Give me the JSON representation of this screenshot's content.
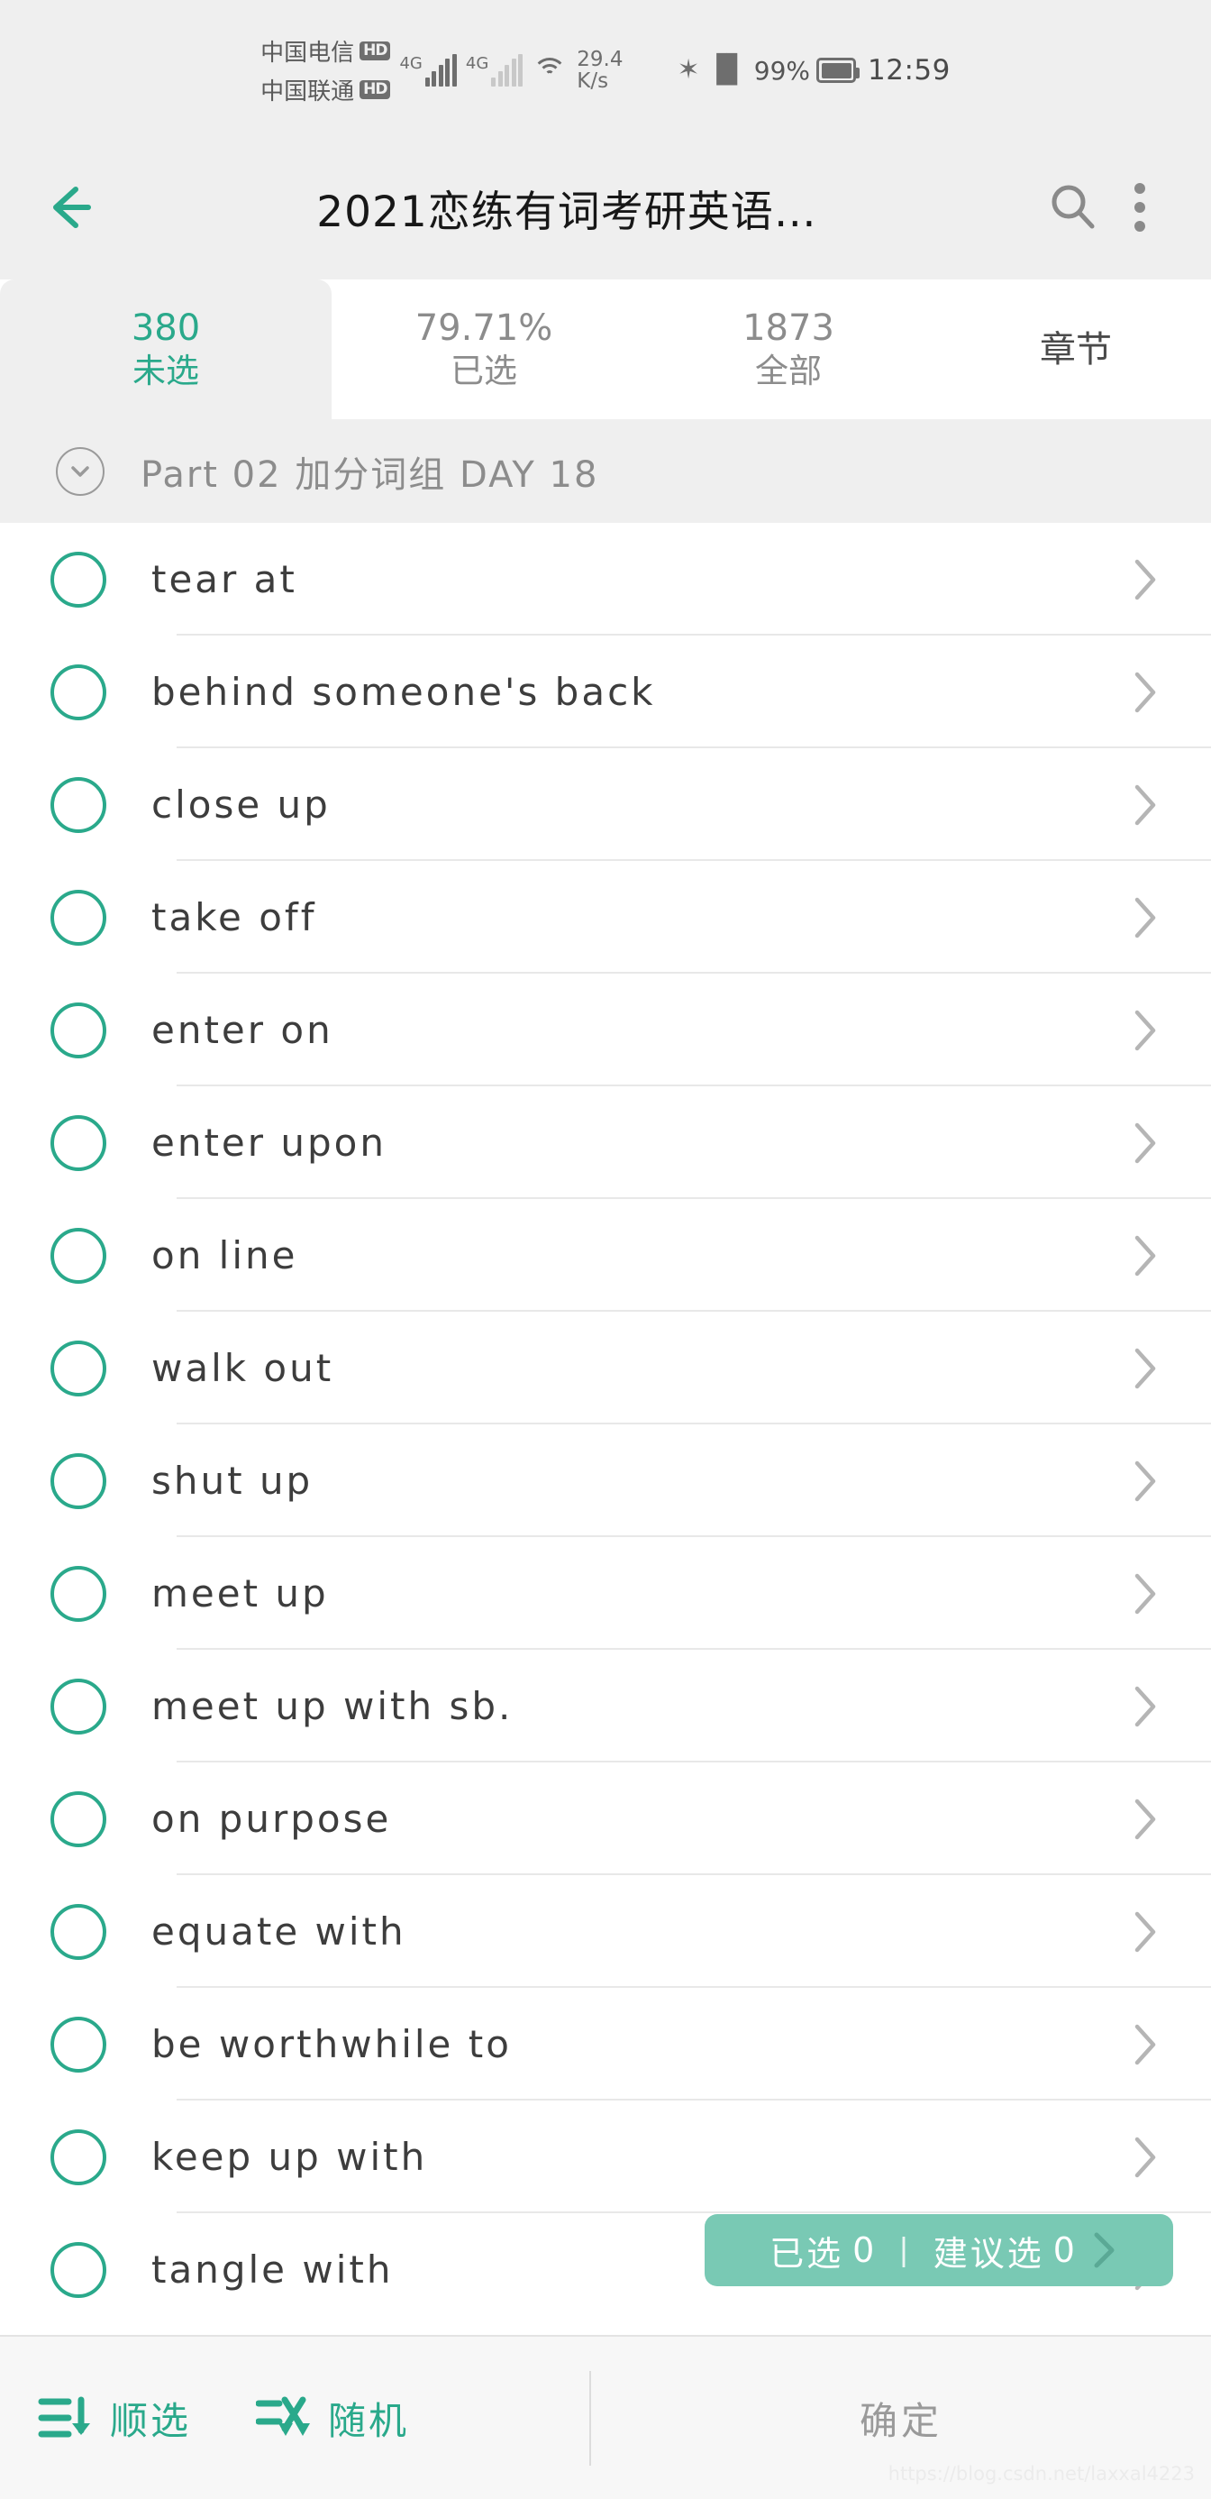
{
  "statusbar": {
    "carrier1": "中国电信",
    "carrier1_badge": "HD",
    "carrier2": "中国联通",
    "carrier2_badge": "HD",
    "net1": "4G",
    "net2": "4G",
    "netspeed_value": "29.4",
    "netspeed_unit": "K/s",
    "bluetooth_icon": "bluetooth-icon",
    "vibrate_icon": "vibrate-icon",
    "battery_percent": "99%",
    "time": "12:59"
  },
  "appbar": {
    "back_icon": "back-arrow-icon",
    "title": "2021恋练有词考研英语…",
    "search_icon": "search-icon",
    "overflow_icon": "overflow-menu-icon"
  },
  "tabs": [
    {
      "num": "380",
      "label": "未选",
      "active": true
    },
    {
      "num": "79.71%",
      "label": "已选",
      "active": false
    },
    {
      "num": "1873",
      "label": "全部",
      "active": false
    }
  ],
  "chapter_tab": {
    "label": "章节"
  },
  "section": {
    "toggle_icon": "chevron-down-icon",
    "label": "Part 02 加分词组 DAY 18"
  },
  "list": {
    "items": [
      {
        "word": "tear at"
      },
      {
        "word": "behind someone's back"
      },
      {
        "word": "close up"
      },
      {
        "word": "take off"
      },
      {
        "word": "enter on"
      },
      {
        "word": "enter upon"
      },
      {
        "word": "on line"
      },
      {
        "word": "walk out"
      },
      {
        "word": "shut up"
      },
      {
        "word": "meet up"
      },
      {
        "word": "meet up with sb."
      },
      {
        "word": "on purpose"
      },
      {
        "word": "equate with"
      },
      {
        "word": "be worthwhile to"
      },
      {
        "word": "keep up with"
      },
      {
        "word": "tangle with"
      }
    ]
  },
  "pill": {
    "selected_label": "已选",
    "selected_count": "0",
    "separator": "|",
    "suggest_label": "建议选",
    "suggest_count": "0",
    "chevron_icon": "chevron-right-icon",
    "color": "#79c9b4"
  },
  "bottombar": {
    "sort_icon": "sort-list-down-icon",
    "sort_label": "顺选",
    "shuffle_icon": "shuffle-icon",
    "shuffle_label": "随机",
    "confirm_label": "确定",
    "accent_color": "#2aa98b"
  },
  "watermark": {
    "text": "https://blog.csdn.net/laxxal4223"
  }
}
